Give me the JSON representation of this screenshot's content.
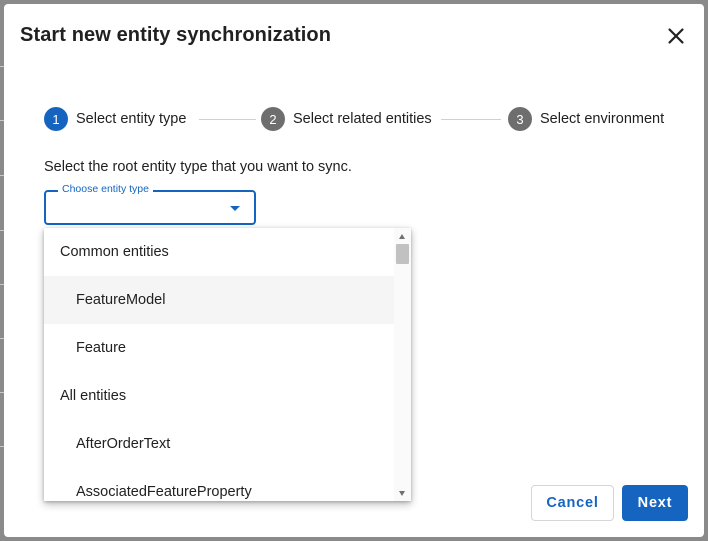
{
  "dialog": {
    "title": "Start new entity synchronization",
    "close_icon": "close-icon"
  },
  "stepper": {
    "steps": [
      {
        "number": "1",
        "label": "Select entity type",
        "state": "active"
      },
      {
        "number": "2",
        "label": "Select related entities",
        "state": "inactive"
      },
      {
        "number": "3",
        "label": "Select environment",
        "state": "inactive"
      }
    ]
  },
  "instruction": "Select the root entity type that you want to sync.",
  "select": {
    "label": "Choose entity type",
    "value": "",
    "icon": "chevron-down-icon"
  },
  "dropdown": {
    "groups": [
      {
        "label": "Common entities",
        "options": [
          "FeatureModel",
          "Feature"
        ]
      },
      {
        "label": "All entities",
        "options": [
          "AfterOrderText",
          "AssociatedFeatureProperty"
        ]
      }
    ],
    "highlighted_option": "FeatureModel"
  },
  "buttons": {
    "cancel": "Cancel",
    "next": "Next"
  },
  "colors": {
    "primary": "#1565c0",
    "step_inactive": "#6e6e6e",
    "text": "#212121"
  }
}
